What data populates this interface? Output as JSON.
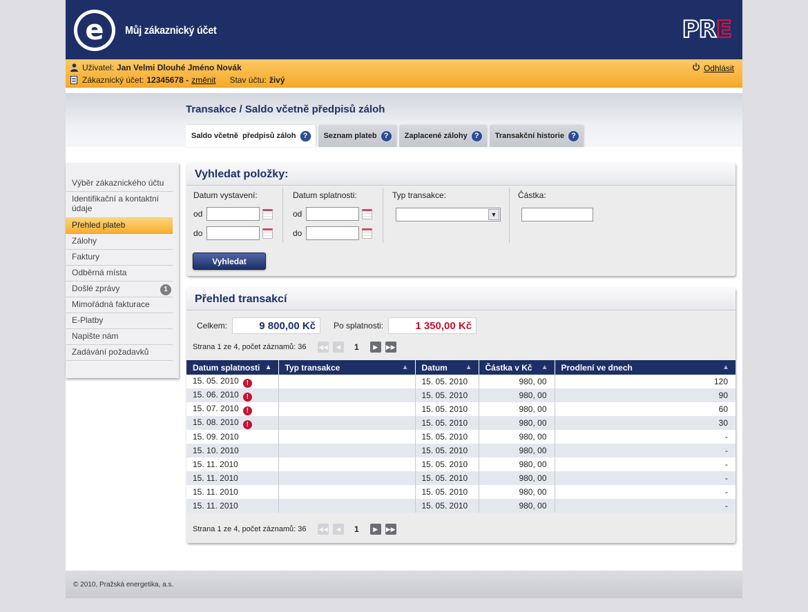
{
  "header": {
    "logo_letter": "e",
    "app_title": "Můj zákaznický účet",
    "brand_logo": "PRE",
    "brand_color": "#1d2f66",
    "accent_color": "#e2103c"
  },
  "userbar": {
    "user_label": "Uživatel:",
    "user_name": "Jan Velmi Dlouhé Jméno Novák",
    "account_label": "Zákaznický účet:",
    "account_number": "12345678 -",
    "change_link": "změnit",
    "status_label": "Stav účtu:",
    "status_value": "živý",
    "logout": "Odhlásit",
    "user_icon": "user-icon",
    "account_icon": "document-icon",
    "logout_icon": "power-icon"
  },
  "page": {
    "title": "Transakce / Saldo včetně předpisů záloh"
  },
  "tabs": [
    {
      "label": "Saldo včetně  předpisů záloh",
      "active": true
    },
    {
      "label": "Seznam plateb",
      "active": false
    },
    {
      "label": "Zaplacené zálohy",
      "active": false
    },
    {
      "label": "Transakční historie",
      "active": false
    }
  ],
  "sidebar": {
    "items": [
      {
        "label": "Výběr zákaznického účtu"
      },
      {
        "label": "Identifikační a kontaktní údaje"
      },
      {
        "label": "Přehled plateb",
        "active": true
      },
      {
        "label": "Zálohy"
      },
      {
        "label": "Faktury"
      },
      {
        "label": "Odběrná místa"
      },
      {
        "label": "Došlé zprávy",
        "badge": "1"
      },
      {
        "label": "Mimořádná fakturace"
      },
      {
        "label": "E-Platby"
      },
      {
        "label": "Napište nám"
      },
      {
        "label": "Zadávání požadavků"
      }
    ]
  },
  "search": {
    "title": "Vyhledat položky:",
    "issue_date_label": "Datum vystavení:",
    "due_date_label": "Datum splatnosti:",
    "type_label": "Typ transakce:",
    "amount_label": "Částka:",
    "from": "od",
    "to": "do",
    "button": "Vyhledat"
  },
  "transactions": {
    "title": "Přehled transakcí",
    "total_label": "Celkem:",
    "total_value": "9 800,00 Kč",
    "overdue_label": "Po splatnosti:",
    "overdue_value": "1 350,00 Kč",
    "pager_text": "Strana 1 ze 4, počet záznamů: 36",
    "current_page": "1",
    "columns": [
      "Datum splatnosti",
      "Typ transakce",
      "Datum",
      "Částka v Kč",
      "Prodlení ve dnech"
    ],
    "rows": [
      {
        "due": "15. 05. 2010",
        "type": "",
        "date": "15. 05. 2010",
        "amount": "980, 00",
        "delay": "120",
        "overdue": true
      },
      {
        "due": "15. 06. 2010",
        "type": "",
        "date": "15. 05. 2010",
        "amount": "980, 00",
        "delay": "90",
        "overdue": true
      },
      {
        "due": "15. 07. 2010",
        "type": "",
        "date": "15. 05. 2010",
        "amount": "980, 00",
        "delay": "60",
        "overdue": true
      },
      {
        "due": "15. 08. 2010",
        "type": "",
        "date": "15. 05. 2010",
        "amount": "980, 00",
        "delay": "30",
        "overdue": true
      },
      {
        "due": "15. 09. 2010",
        "type": "",
        "date": "15. 05. 2010",
        "amount": "980, 00",
        "delay": "-",
        "overdue": false
      },
      {
        "due": "15. 10. 2010",
        "type": "",
        "date": "15. 05. 2010",
        "amount": "980, 00",
        "delay": "-",
        "overdue": false
      },
      {
        "due": "15. 11. 2010",
        "type": "",
        "date": "15. 05. 2010",
        "amount": "980, 00",
        "delay": "-",
        "overdue": false
      },
      {
        "due": "15. 11. 2010",
        "type": "",
        "date": "15. 05. 2010",
        "amount": "980, 00",
        "delay": "-",
        "overdue": false
      },
      {
        "due": "15. 11. 2010",
        "type": "",
        "date": "15. 05. 2010",
        "amount": "980, 00",
        "delay": "-",
        "overdue": false
      },
      {
        "due": "15. 11. 2010",
        "type": "",
        "date": "15. 05. 2010",
        "amount": "980, 00",
        "delay": "-",
        "overdue": false
      }
    ]
  },
  "footer": {
    "copyright": "© 2010, Pražská energetika, a.s."
  }
}
